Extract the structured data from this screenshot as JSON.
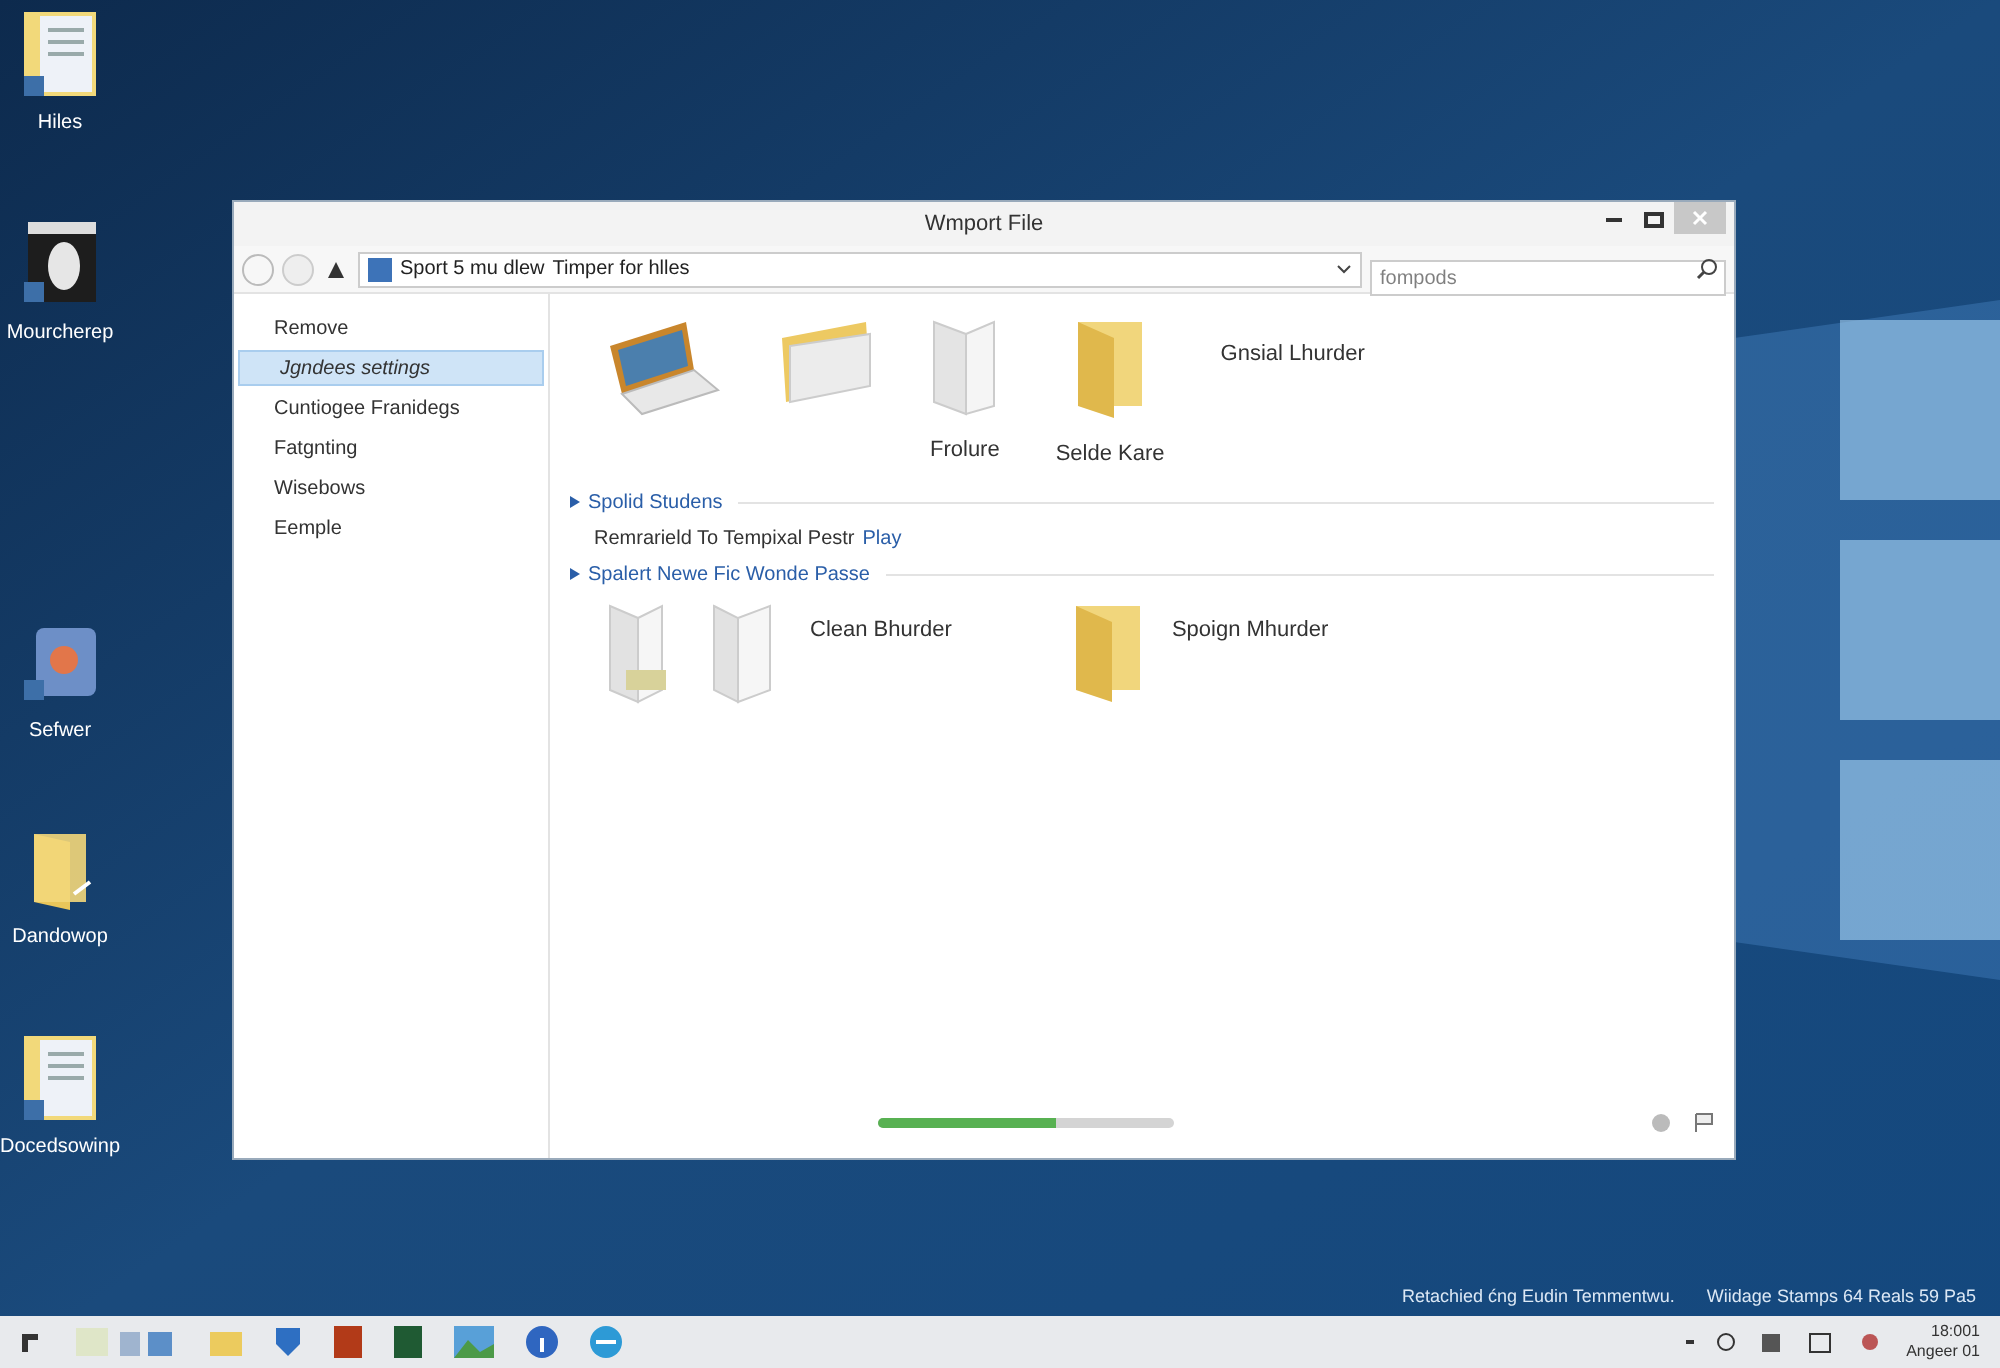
{
  "desktop_icons": [
    {
      "label": "Hiles",
      "kind": "document"
    },
    {
      "label": "Mourcherep",
      "kind": "app"
    },
    {
      "label": "Sefwer",
      "kind": "media"
    },
    {
      "label": "Dandowop",
      "kind": "folder"
    },
    {
      "label": "Docedsowinp",
      "kind": "document"
    }
  ],
  "window": {
    "title": "Wmport File",
    "address": [
      "Sport 5 mu dlew",
      "Timper for hlles"
    ],
    "search": {
      "placeholder": "fompods"
    },
    "sidebar": [
      {
        "label": "Remove",
        "selected": false
      },
      {
        "label": "Jgndees settings",
        "selected": true
      },
      {
        "label": "Cuntiogee Franidegs",
        "selected": false
      },
      {
        "label": "Fatgnting",
        "selected": false
      },
      {
        "label": "Wisebows",
        "selected": false
      },
      {
        "label": "Eemple",
        "selected": false
      }
    ],
    "top_items": [
      {
        "kind": "laptop"
      },
      {
        "kind": "folder-open"
      },
      {
        "kind": "page",
        "label": "Frolure"
      },
      {
        "kind": "folder",
        "label": "Selde Kare"
      }
    ],
    "top_heading": "Gnsial Lhurder",
    "section_1": {
      "title": "Spolid Studens",
      "text": "Remrarield To Tempixal Pestr",
      "link": "Play"
    },
    "section_2": {
      "title": "Spalert Newe Fic Wonde Passe"
    },
    "bottom_items": [
      {
        "kind": "pages",
        "label": "Clean Bhurder"
      },
      {
        "kind": "folder",
        "label": "Spoign Mhurder"
      }
    ],
    "progress": {
      "level": 0.6
    }
  },
  "notifications": [
    "Retachied ćng Eudin Temmentwu.",
    "Wiidage Stamps 64 Reals 59 Pa5"
  ],
  "clock": {
    "time": "18:001",
    "date": "Angeer 01"
  }
}
